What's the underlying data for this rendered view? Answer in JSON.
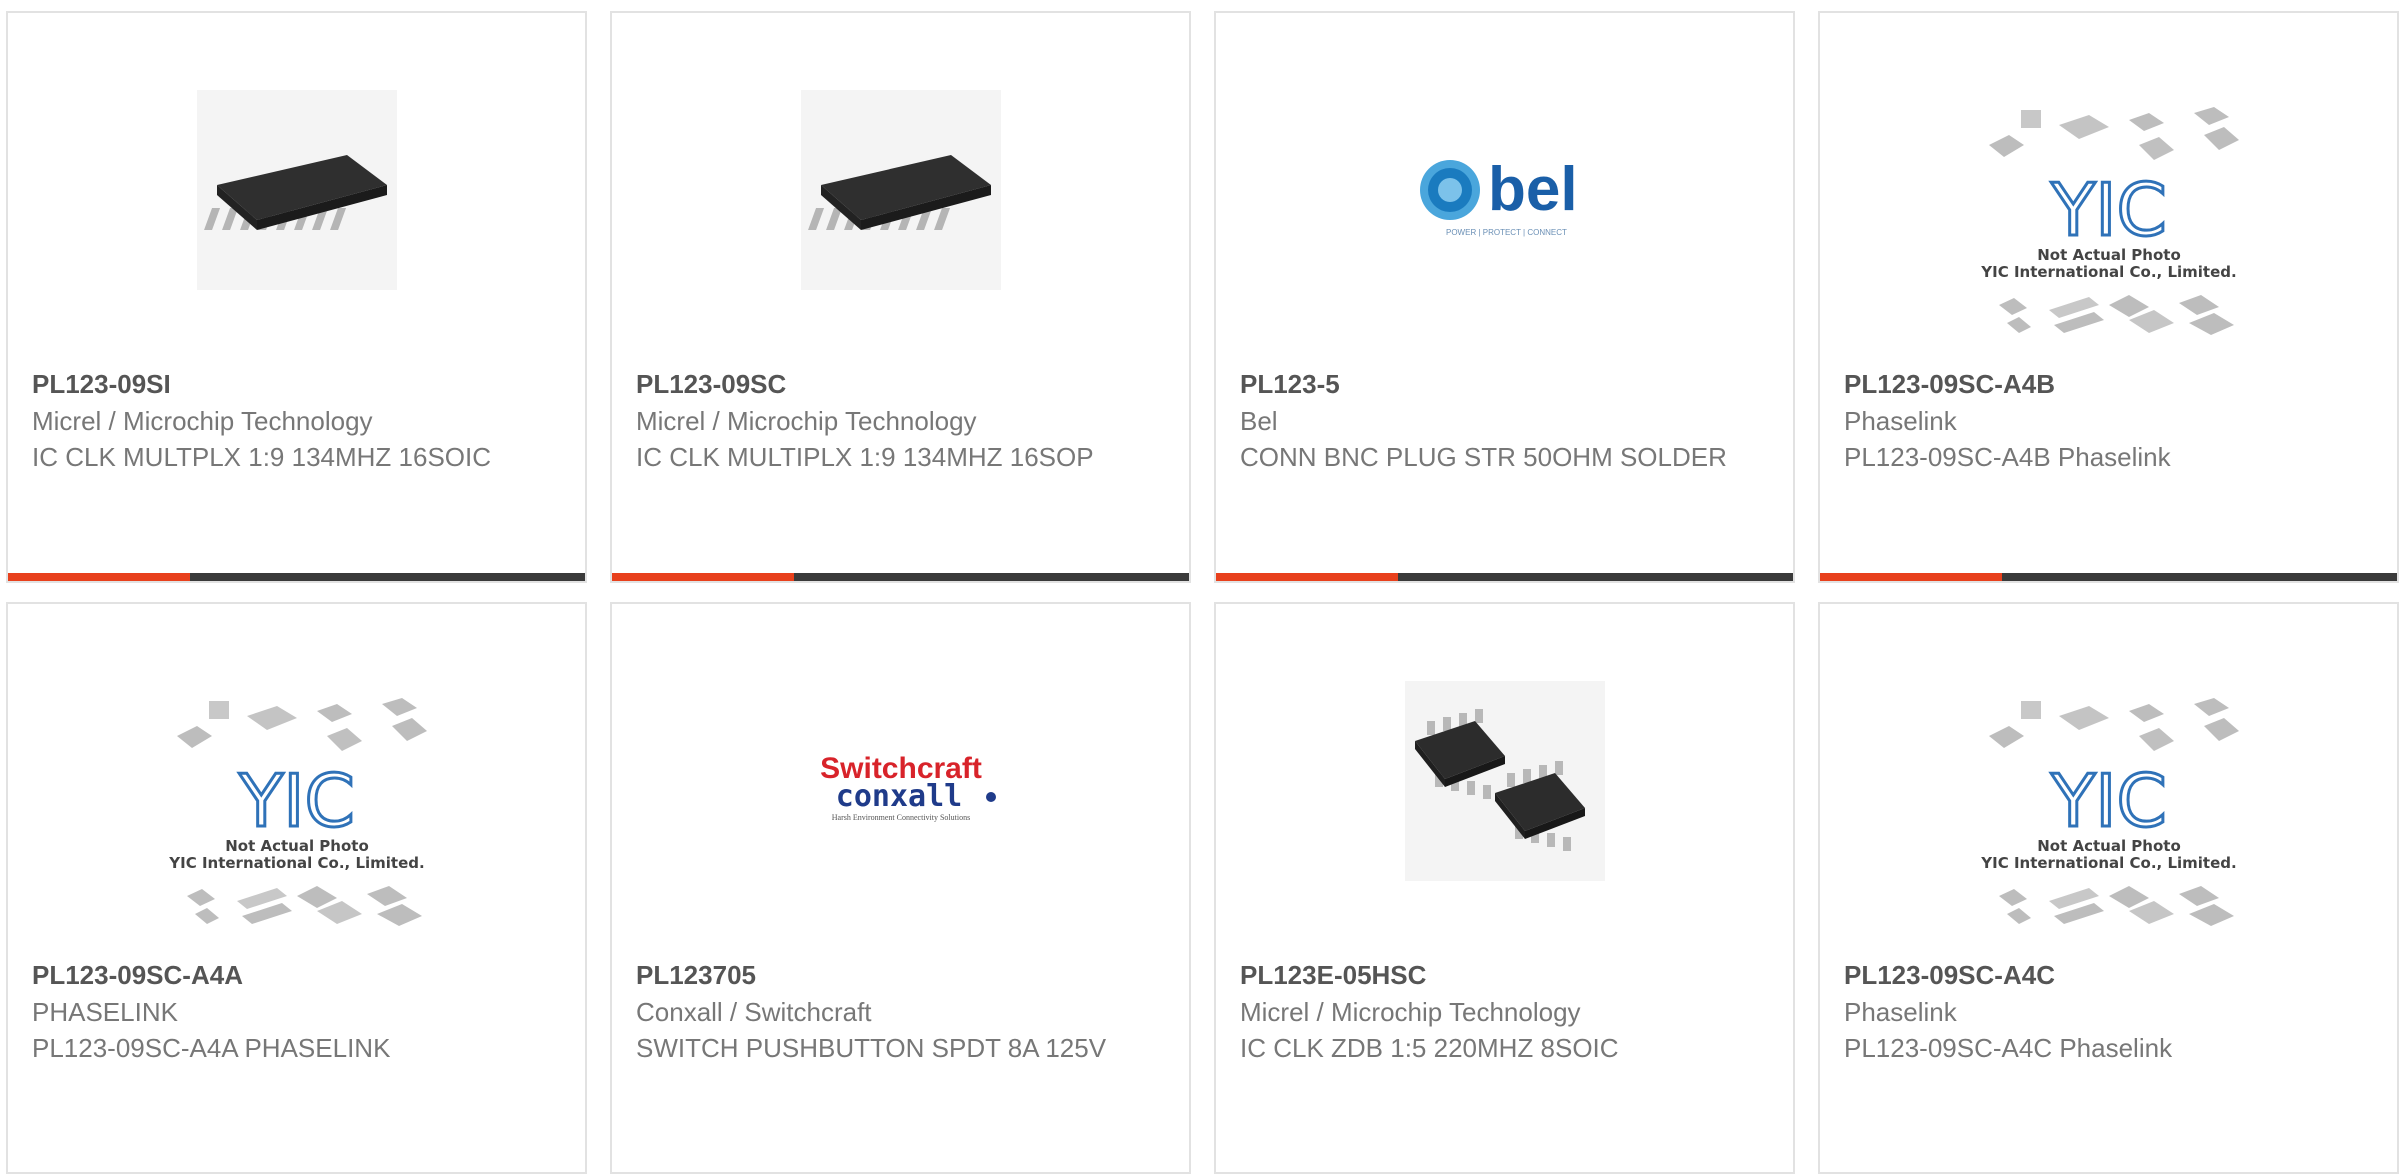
{
  "products": [
    {
      "part_number": "PL123-09SI",
      "manufacturer": "Micrel / Microchip Technology",
      "description": "IC CLK MULTPLX 1:9 134MHZ 16SOIC",
      "image": "soic-16-chip-icon"
    },
    {
      "part_number": "PL123-09SC",
      "manufacturer": "Micrel / Microchip Technology",
      "description": "IC CLK MULTIPLX 1:9 134MHZ 16SOP",
      "image": "soic-16-chip-icon"
    },
    {
      "part_number": "PL123-5",
      "manufacturer": "Bel",
      "description": "CONN BNC PLUG STR 50OHM SOLDER",
      "image": "bel-logo"
    },
    {
      "part_number": "PL123-09SC-A4B",
      "manufacturer": "Phaselink",
      "description": "PL123-09SC-A4B Phaselink",
      "image": "yic-not-actual-photo"
    },
    {
      "part_number": "PL123-09SC-A4A",
      "manufacturer": "PHASELINK",
      "description": "PL123-09SC-A4A PHASELINK",
      "image": "yic-not-actual-photo"
    },
    {
      "part_number": "PL123705",
      "manufacturer": "Conxall / Switchcraft",
      "description": "SWITCH PUSHBUTTON SPDT 8A 125V",
      "image": "switchcraft-conxall-logo"
    },
    {
      "part_number": "PL123E-05HSC",
      "manufacturer": "Micrel / Microchip Technology",
      "description": "IC CLK ZDB 1:5 220MHZ 8SOIC",
      "image": "soic-8-chips-icon"
    },
    {
      "part_number": "PL123-09SC-A4C",
      "manufacturer": "Phaselink",
      "description": "PL123-09SC-A4C Phaselink",
      "image": "yic-not-actual-photo"
    }
  ],
  "logos": {
    "bel": {
      "word": "bel",
      "tagline": "POWER | PROTECT | CONNECT"
    },
    "yic": {
      "mark": "YIC",
      "line1": "Not Actual Photo",
      "line2": "YIC International Co., Limited."
    },
    "switchcraft": {
      "line1": "Switchcraft",
      "line2": "conxall",
      "line3": "Harsh Environment Connectivity Solutions"
    }
  },
  "colors": {
    "accent": "#e8401c",
    "bar": "#3a3a3a",
    "bel_blue": "#1a7bbf",
    "switchcraft_red": "#d8232a",
    "conxall_blue": "#1f3b8a"
  }
}
